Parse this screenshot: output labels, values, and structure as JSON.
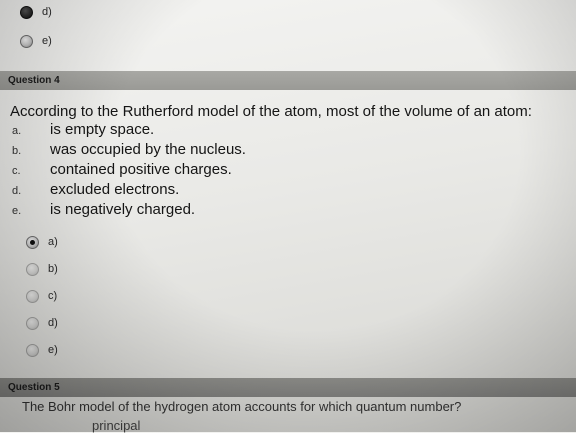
{
  "prev_options": [
    {
      "label": "d)",
      "style": "dark"
    },
    {
      "label": "e)",
      "style": "normal"
    }
  ],
  "question4": {
    "header": "Question 4",
    "text": "According to the Rutherford model of the atom, most of the volume of an atom:",
    "answers": [
      {
        "letter": "a.",
        "text": "is empty space."
      },
      {
        "letter": "b.",
        "text": "was occupied by the nucleus."
      },
      {
        "letter": "c.",
        "text": "contained positive charges."
      },
      {
        "letter": "d.",
        "text": "excluded electrons."
      },
      {
        "letter": "e.",
        "text": "is negatively charged."
      }
    ],
    "options": [
      {
        "label": "a)",
        "selected": true
      },
      {
        "label": "b)",
        "selected": false
      },
      {
        "label": "c)",
        "selected": false
      },
      {
        "label": "d)",
        "selected": false
      },
      {
        "label": "e)",
        "selected": false
      }
    ]
  },
  "question5": {
    "header": "Question 5",
    "text": "The Bohr model of the hydrogen atom accounts for which quantum number?",
    "partial_option": "principal"
  },
  "colors": {
    "header_bar": "#9a9a96",
    "background": "#ececea"
  }
}
